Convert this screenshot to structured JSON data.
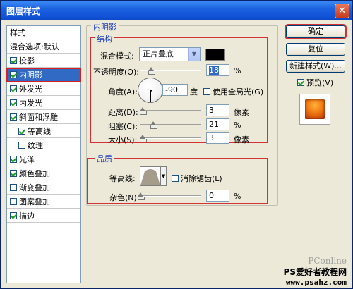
{
  "window": {
    "title": "图层样式",
    "close_glyph": "✕"
  },
  "style_list": {
    "items": [
      {
        "label": "样式",
        "checkbox": false,
        "checked": false,
        "sub": false,
        "selected": false
      },
      {
        "label": "混合选项:默认",
        "checkbox": false,
        "checked": false,
        "sub": false,
        "selected": false
      },
      {
        "label": "投影",
        "checkbox": true,
        "checked": true,
        "sub": false,
        "selected": false
      },
      {
        "label": "内阴影",
        "checkbox": true,
        "checked": true,
        "sub": false,
        "selected": true
      },
      {
        "label": "外发光",
        "checkbox": true,
        "checked": true,
        "sub": false,
        "selected": false
      },
      {
        "label": "内发光",
        "checkbox": true,
        "checked": true,
        "sub": false,
        "selected": false
      },
      {
        "label": "斜面和浮雕",
        "checkbox": true,
        "checked": true,
        "sub": false,
        "selected": false
      },
      {
        "label": "等高线",
        "checkbox": true,
        "checked": true,
        "sub": true,
        "selected": false
      },
      {
        "label": "纹理",
        "checkbox": true,
        "checked": false,
        "sub": true,
        "selected": false
      },
      {
        "label": "光泽",
        "checkbox": true,
        "checked": true,
        "sub": false,
        "selected": false
      },
      {
        "label": "颜色叠加",
        "checkbox": true,
        "checked": true,
        "sub": false,
        "selected": false
      },
      {
        "label": "渐变叠加",
        "checkbox": true,
        "checked": false,
        "sub": false,
        "selected": false
      },
      {
        "label": "图案叠加",
        "checkbox": true,
        "checked": false,
        "sub": false,
        "selected": false
      },
      {
        "label": "描边",
        "checkbox": true,
        "checked": true,
        "sub": false,
        "selected": false
      }
    ]
  },
  "panel": {
    "title": "内阴影",
    "structure": {
      "title": "结构",
      "blend_mode_label": "混合模式:",
      "blend_mode_value": "正片叠底",
      "shadow_color": "#000000",
      "opacity_label": "不透明度(O):",
      "opacity_value": "18",
      "opacity_unit": "%",
      "angle_label": "角度(A):",
      "angle_value": "-90",
      "angle_unit": "度",
      "global_light_label": "使用全局光(G)",
      "global_light_checked": false,
      "distance_label": "距离(D):",
      "distance_value": "3",
      "distance_unit": "像素",
      "choke_label": "阻塞(C):",
      "choke_value": "21",
      "choke_unit": "%",
      "size_label": "大小(S):",
      "size_value": "3",
      "size_unit": "像素"
    },
    "quality": {
      "title": "品质",
      "contour_label": "等高线:",
      "antialias_label": "消除锯齿(L)",
      "antialias_checked": false,
      "noise_label": "杂色(N):",
      "noise_value": "0",
      "noise_unit": "%"
    }
  },
  "buttons": {
    "ok": "确定",
    "reset": "复位",
    "new_style": "新建样式(W)...",
    "preview_label": "预览(V)",
    "preview_checked": true
  },
  "watermark": {
    "logo": "PConline",
    "line1": "PS爱好者教程网",
    "line2": "www.psahz.com"
  },
  "colors": {
    "title_bar": "#1c63e0",
    "selection": "#316ac5",
    "group_title": "#1a3ebb",
    "highlight_box": "#d23232"
  }
}
